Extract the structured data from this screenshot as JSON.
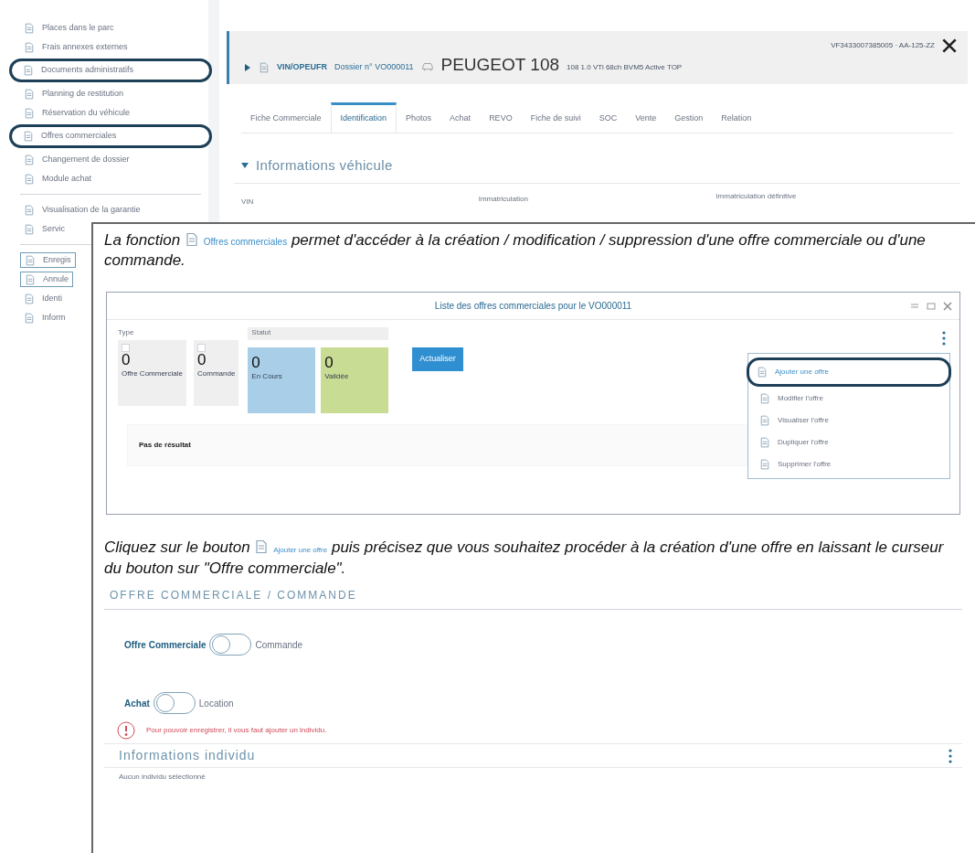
{
  "sidebar": {
    "groups": [
      {
        "items": [
          {
            "label": "Places dans le parc",
            "circled": false,
            "boxed": false
          },
          {
            "label": "Frais annexes externes",
            "circled": false,
            "boxed": false
          },
          {
            "label": "Documents administratifs",
            "circled": true,
            "boxed": false
          },
          {
            "label": "Planning de restitution",
            "circled": false,
            "boxed": false
          },
          {
            "label": "Réservation du véhicule",
            "circled": false,
            "boxed": false
          },
          {
            "label": "Offres commerciales",
            "circled": true,
            "boxed": false
          },
          {
            "label": "Changement de dossier",
            "circled": false,
            "boxed": false
          },
          {
            "label": "Module achat",
            "circled": false,
            "boxed": false
          }
        ]
      },
      {
        "items": [
          {
            "label": "Visualisation de la garantie",
            "circled": false,
            "boxed": false
          },
          {
            "label": "Servic",
            "circled": false,
            "boxed": false
          }
        ]
      },
      {
        "items": [
          {
            "label": "Enregis",
            "circled": false,
            "boxed": true
          },
          {
            "label": "Annule",
            "circled": false,
            "boxed": true
          },
          {
            "label": "Identi",
            "circled": false,
            "boxed": false
          },
          {
            "label": "Inform",
            "circled": false,
            "boxed": false
          }
        ]
      }
    ]
  },
  "vehicle_header": {
    "code": "VIN/OPEUFR",
    "dossier": "Dossier n° VO000011",
    "make_model": "PEUGEOT 108",
    "version": "108 1.0 VTi 68ch BVM5 Active TOP",
    "vin_plate": "VF3433007385005 · AA-125-ZZ"
  },
  "tabs": [
    {
      "label": "Fiche Commerciale",
      "selected": false
    },
    {
      "label": "Identification",
      "selected": true
    },
    {
      "label": "Photos",
      "selected": false
    },
    {
      "label": "Achat",
      "selected": false
    },
    {
      "label": "REVO",
      "selected": false
    },
    {
      "label": "Fiche de suivi",
      "selected": false
    },
    {
      "label": "SOC",
      "selected": false
    },
    {
      "label": "Vente",
      "selected": false
    },
    {
      "label": "Gestion",
      "selected": false
    },
    {
      "label": "Relation",
      "selected": false
    }
  ],
  "vehicle_section": {
    "title": "Informations véhicule",
    "expanded": true,
    "fields": [
      "VIN",
      "Immatriculation",
      "Immatriculation définitive"
    ]
  },
  "doc": {
    "intro_before": "La fonction",
    "intro_link": "Offres commerciales",
    "intro_after": "permet d'accéder à la création / modification / suppression d'une offre commerciale ou d'une commande.",
    "dialog": {
      "title": "Liste des offres commerciales pour le VO000011",
      "type_label": "Type",
      "type_tiles": [
        {
          "count": "0",
          "label": "Offre Commerciale"
        },
        {
          "count": "0",
          "label": "Commande"
        }
      ],
      "status_label": "Statut",
      "status_tiles": [
        {
          "count": "0",
          "label": "En Cours",
          "color": "#a9cfe8"
        },
        {
          "count": "0",
          "label": "Validée",
          "color": "#c8dc94"
        }
      ],
      "refresh_button": "Actualiser",
      "empty_text": "Pas de résultat",
      "menu": [
        {
          "label": "Ajouter une offre",
          "disabled": false,
          "circled": true
        },
        {
          "label": "Modifier l'offre",
          "disabled": true,
          "circled": false
        },
        {
          "label": "Visualiser l'offre",
          "disabled": true,
          "circled": false
        },
        {
          "label": "Dupliquer l'offre",
          "disabled": true,
          "circled": false
        },
        {
          "label": "Supprimer l'offre",
          "disabled": true,
          "circled": false
        }
      ]
    },
    "step_before": "Cliquez sur le bouton",
    "step_link": "Ajouter une offre",
    "step_after": "puis précisez que vous souhaitez procéder à la création d'une offre en laissant le curseur du bouton sur \"Offre commerciale\".",
    "form": {
      "title": "OFFRE COMMERCIALE / COMMANDE",
      "toggles": [
        {
          "left": "Offre Commerciale",
          "right": "Commande",
          "on": false
        },
        {
          "left": "Achat",
          "right": "Location",
          "on": false
        }
      ],
      "error": "Pour pouvoir enregistrer, il vous faut ajouter un individu.",
      "individual_title": "Informations individu",
      "individual_empty": "Aucun individu sélectionné"
    }
  }
}
